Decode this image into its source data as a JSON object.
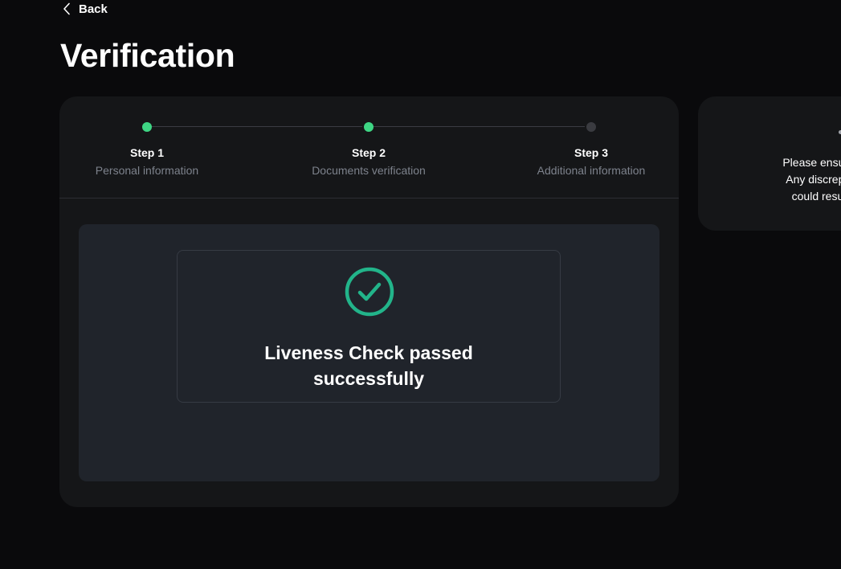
{
  "header": {
    "back_label": "Back",
    "title": "Verification"
  },
  "stepper": {
    "steps": [
      {
        "title": "Step 1",
        "subtitle": "Personal information",
        "status": "completed"
      },
      {
        "title": "Step 2",
        "subtitle": "Documents verification",
        "status": "completed"
      },
      {
        "title": "Step 3",
        "subtitle": "Additional information",
        "status": "pending"
      }
    ]
  },
  "result": {
    "icon": "check-circle-icon",
    "message_line1": "Liveness Check passed",
    "message_line2": "successfully"
  },
  "notice": {
    "lines": [
      "Please ensure you ent",
      "Any discrepancy with",
      "could result in verif"
    ]
  },
  "colors": {
    "background": "#0a0a0c",
    "card": "#151618",
    "inner_panel": "#20242b",
    "step_done": "#3ed684",
    "step_pending": "#3a3b40",
    "success_icon": "#22b48a",
    "muted_text": "#7d828c"
  }
}
